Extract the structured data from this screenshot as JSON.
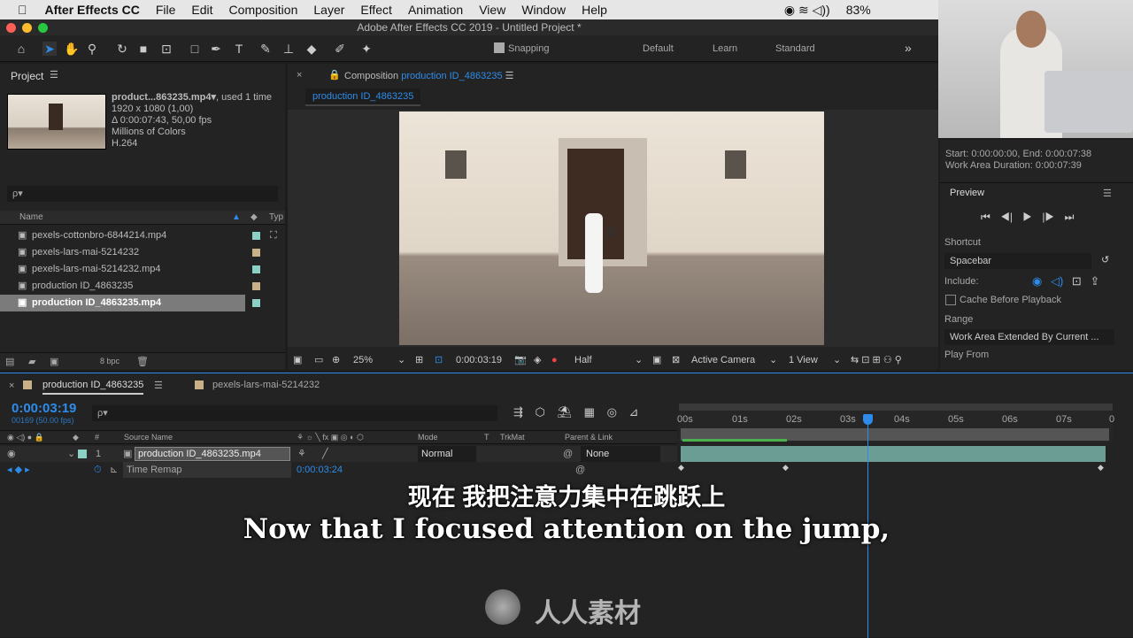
{
  "menubar": {
    "app": "After Effects CC",
    "items": [
      "File",
      "Edit",
      "Composition",
      "Layer",
      "Effect",
      "Animation",
      "View",
      "Window",
      "Help"
    ],
    "battery": "83%"
  },
  "titlebar": "Adobe After Effects CC 2019 - Untitled Project *",
  "toolbar": {
    "snapping": "Snapping",
    "workspaces": [
      "Default",
      "Learn",
      "Standard"
    ]
  },
  "project": {
    "title": "Project",
    "selected_name": "product...863235.mp4▾",
    "used": ", used 1 time",
    "info": [
      "1920 x 1080 (1,00)",
      "Δ 0:00:07:43, 50,00 fps",
      "Millions of Colors",
      "H.264"
    ],
    "search_placeholder": "ρ▾",
    "col_name": "Name",
    "col_type": "Typ",
    "items": [
      "pexels-cottonbro-6844214.mp4",
      "pexels-lars-mai-5214232",
      "pexels-lars-mai-5214232.mp4",
      "production ID_4863235",
      "production ID_4863235.mp4"
    ],
    "bpc": "8 bpc"
  },
  "composition": {
    "label": "Composition",
    "name": "production ID_4863235",
    "tab": "production ID_4863235",
    "zoom": "25%",
    "timecode": "0:00:03:19",
    "resolution": "Half",
    "camera": "Active Camera",
    "views": "1 View"
  },
  "info_panel": {
    "start_end": "Start: 0:00:00:00, End: 0:00:07:38",
    "work_area": "Work Area Duration: 0:00:07:39"
  },
  "preview": {
    "title": "Preview",
    "shortcut_label": "Shortcut",
    "shortcut": "Spacebar",
    "include": "Include:",
    "cache": "Cache Before Playback",
    "range_label": "Range",
    "range": "Work Area Extended By Current ...",
    "play_from": "Play From"
  },
  "timeline": {
    "tabs": [
      "production ID_4863235",
      "pexels-lars-mai-5214232"
    ],
    "timecode": "0:00:03:19",
    "frames": "00169 (50.00 fps)",
    "col_source": "Source Name",
    "col_mode": "Mode",
    "col_t": "T",
    "col_trkmat": "TrkMat",
    "col_parent": "Parent & Link",
    "layer_num": "1",
    "layer_name": "production ID_4863235.mp4",
    "mode": "Normal",
    "parent": "None",
    "prop": "Time Remap",
    "prop_value": "0:00:03:24",
    "ruler": [
      "00s",
      "01s",
      "02s",
      "03s",
      "04s",
      "05s",
      "06s",
      "07s",
      "0"
    ]
  },
  "subtitles": {
    "zh": "现在 我把注意力集中在跳跃上",
    "en": "Now that I focused attention on the jump,"
  },
  "watermark": "人人素材",
  "colors": {
    "accent": "#2d8ceb",
    "teal": "#8ccfc4",
    "tan": "#c8b088"
  }
}
